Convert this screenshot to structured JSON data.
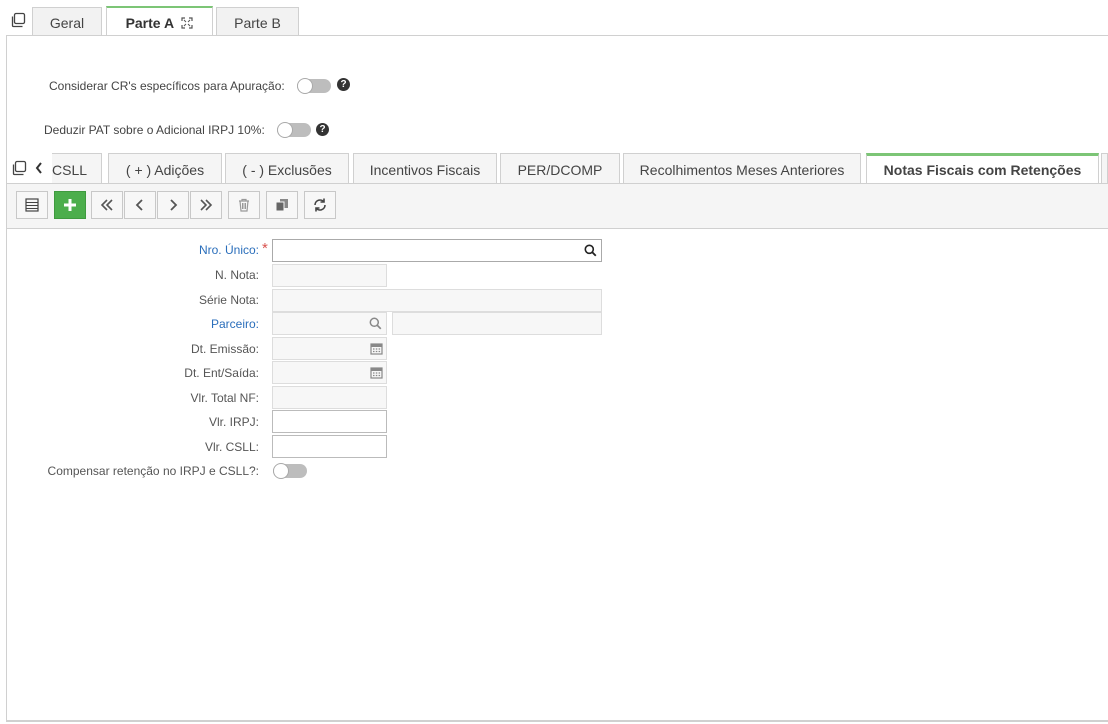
{
  "top_tabs": [
    {
      "label": "Geral"
    },
    {
      "label": "Parte A"
    },
    {
      "label": "Parte B"
    }
  ],
  "options": {
    "considerar_label": "Considerar CR's específicos para Apuração:",
    "deduzir_label": "Deduzir PAT sobre o Adicional IRPJ 10%:",
    "help_glyph": "?"
  },
  "sub_tabs": [
    {
      "label": "CSLL"
    },
    {
      "label": "( + ) Adições"
    },
    {
      "label": "( - ) Exclusões"
    },
    {
      "label": "Incentivos Fiscais"
    },
    {
      "label": "PER/DCOMP"
    },
    {
      "label": "Recolhimentos Meses Anteriores"
    },
    {
      "label": "Notas Fiscais com Retenções"
    }
  ],
  "form": {
    "nro_unico": "Nro. Único:",
    "required_mark": "*",
    "n_nota": "N. Nota:",
    "serie_nota": "Série Nota:",
    "parceiro": "Parceiro:",
    "dt_emissao": "Dt. Emissão:",
    "dt_ent_saida": "Dt. Ent/Saída:",
    "vlr_total_nf": "Vlr. Total NF:",
    "vlr_irpj": "Vlr. IRPJ:",
    "vlr_csll": "Vlr. CSLL:",
    "compensar": "Compensar retenção no IRPJ e CSLL?:"
  },
  "colors": {
    "accent_green": "#7cc576",
    "add_button": "#4cae4c",
    "link_blue": "#2a6ebb",
    "required_red": "#d9534f"
  }
}
